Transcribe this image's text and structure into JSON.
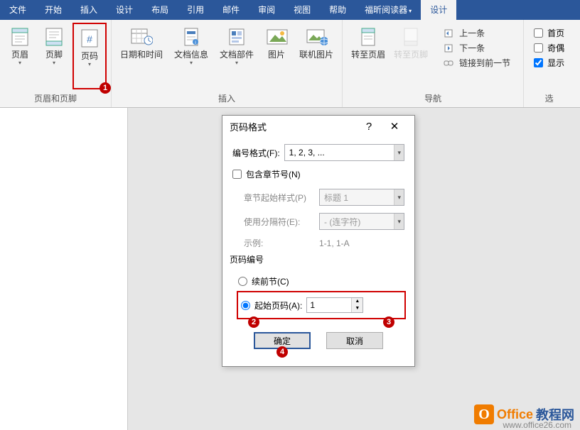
{
  "tabs": {
    "file": "文件",
    "home": "开始",
    "insert": "插入",
    "design": "设计",
    "layout": "布局",
    "references": "引用",
    "mailings": "邮件",
    "review": "审阅",
    "view": "视图",
    "help": "帮助",
    "foxit": "福昕阅读器",
    "designer": "设计"
  },
  "ribbon": {
    "group_hf": "页眉和页脚",
    "header": "页眉",
    "footer": "页脚",
    "page_number": "页码",
    "group_insert": "插入",
    "datetime": "日期和时间",
    "docinfo": "文档信息",
    "quickparts": "文档部件",
    "picture": "图片",
    "online_picture": "联机图片",
    "goto_header": "转至页眉",
    "goto_footer": "转至页脚",
    "group_nav": "导航",
    "nav_prev": "上一条",
    "nav_next": "下一条",
    "nav_link": "链接到前一节",
    "group_opts": "选",
    "opt_first": "首页",
    "opt_oddeven": "奇偶",
    "opt_show": "显示"
  },
  "dialog": {
    "title": "页码格式",
    "help": "?",
    "close": "✕",
    "number_format_label": "编号格式(F):",
    "number_format_value": "1, 2, 3, ...",
    "include_chapter": "包含章节号(N)",
    "chapter_style_label": "章节起始样式(P)",
    "chapter_style_value": "标题 1",
    "separator_label": "使用分隔符(E):",
    "separator_value": "- (连字符)",
    "example_label": "示例:",
    "example_value": "1-1, 1-A",
    "page_numbering": "页码编号",
    "continue_prev": "续前节(C)",
    "start_at": "起始页码(A):",
    "start_value": "1",
    "ok": "确定",
    "cancel": "取消"
  },
  "callouts": {
    "c1": "1",
    "c2": "2",
    "c3": "3",
    "c4": "4"
  },
  "watermark": {
    "brand1": "Office",
    "brand2": "教程网",
    "url": "www.office26.com"
  }
}
